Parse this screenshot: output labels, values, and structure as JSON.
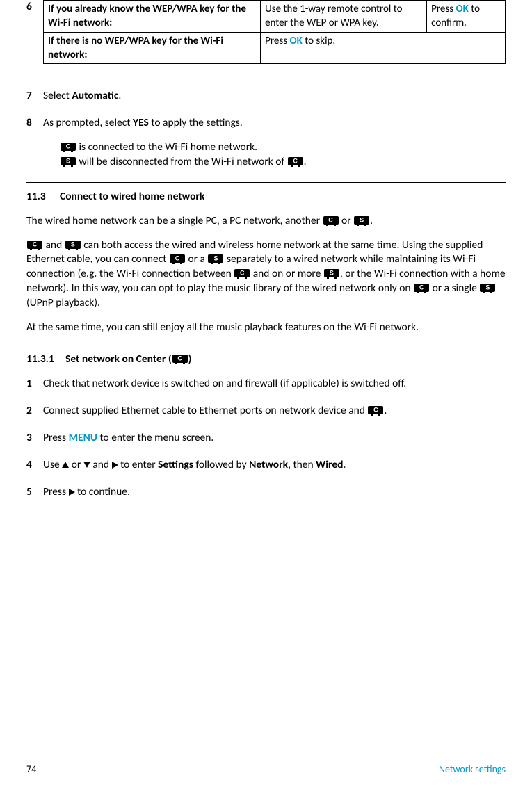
{
  "table": {
    "row1": {
      "c1": "If you already know the WEP/WPA key for the Wi-Fi network:",
      "c2": "Use the 1-way remote control to enter the WEP or WPA key.",
      "c3a": "Press ",
      "c3ok": "OK",
      "c3b": " to confirm."
    },
    "row2": {
      "c1": "If there is no WEP/WPA key for the Wi-Fi network:",
      "c2a": "Press ",
      "c2ok": "OK",
      "c2b": " to skip."
    }
  },
  "step6": "6",
  "step7": {
    "num": "7",
    "a": "Select ",
    "b": "Automatic",
    "c": "."
  },
  "step8": {
    "num": "8",
    "a": "As prompted, select ",
    "b": "YES",
    "c": " to apply the settings.",
    "line1a": " is connected to the Wi-Fi home network.",
    "line2a": " will be disconnected from the Wi-Fi network of ",
    "line2b": "."
  },
  "sec113": {
    "num": "11.3",
    "title": "Connect to wired home network",
    "intro_a": "The wired home network can be a single PC, a PC network, another ",
    "intro_b": " or ",
    "intro_c": ".",
    "p2_a": " and ",
    "p2_b": " can both access the wired and wireless home network at the same time. Using the supplied Ethernet cable, you can connect ",
    "p2_c": " or a ",
    "p2_d": " separately to a wired network while maintaining its Wi-Fi connection (e.g. the Wi-Fi connection between ",
    "p2_e": " and on or more ",
    "p2_f": ", or the Wi-Fi connection with a home network). In this way, you can opt to play the music library of the wired network only on ",
    "p2_g": " or a single ",
    "p2_h": " (UPnP playback).",
    "p3": "At the same time, you can still enjoy all the music playback features on the Wi-Fi network."
  },
  "sec1131": {
    "num": "11.3.1",
    "title_a": "Set network on Center (",
    "title_b": ")",
    "s1": {
      "num": "1",
      "text": "Check that network device is switched on and firewall (if applicable) is switched off."
    },
    "s2": {
      "num": "2",
      "a": "Connect supplied Ethernet cable to Ethernet ports on network device and ",
      "b": "."
    },
    "s3": {
      "num": "3",
      "a": "Press ",
      "menu": "MENU",
      "b": " to enter the menu screen."
    },
    "s4": {
      "num": "4",
      "a": "Use ",
      "b": " or ",
      "c": " and ",
      "d": " to enter ",
      "settings": "Settings",
      "e": " followed by ",
      "network": "Network",
      "f": ", then ",
      "wired": "Wired",
      "g": "."
    },
    "s5": {
      "num": "5",
      "a": "Press ",
      "b": " to continue."
    }
  },
  "footer": {
    "page": "74",
    "section": "Network settings"
  }
}
